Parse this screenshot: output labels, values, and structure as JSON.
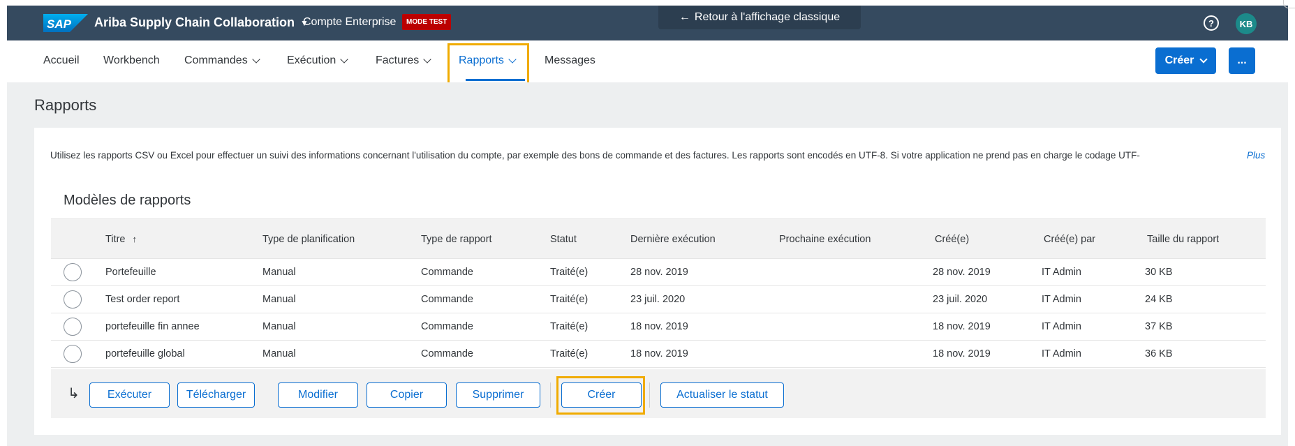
{
  "shell": {
    "logo_text": "SAP",
    "app_title": "Ariba Supply Chain Collaboration",
    "account": "Compte Enterprise",
    "mode_badge": "MODE TEST",
    "classic_view": "Retour à l'affichage classique",
    "help_icon_glyph": "?",
    "avatar_initials": "KB"
  },
  "nav": {
    "items": [
      {
        "label": "Accueil"
      },
      {
        "label": "Workbench"
      },
      {
        "label": "Commandes"
      },
      {
        "label": "Exécution"
      },
      {
        "label": "Factures"
      },
      {
        "label": "Rapports"
      },
      {
        "label": "Messages"
      }
    ],
    "active": "Rapports",
    "create_label": "Créer",
    "more_label": "..."
  },
  "page": {
    "title": "Rapports",
    "intro": "Utilisez les rapports CSV ou Excel pour effectuer un suivi des informations concernant l'utilisation du compte, par exemple des bons de commande et des factures. Les rapports sont encodés en UTF-8. Si votre application ne prend pas en charge le codage UTF-",
    "more_link": "Plus"
  },
  "templates": {
    "title": "Modèles de rapports",
    "columns": [
      "Titre",
      "Type de planification",
      "Type de rapport",
      "Statut",
      "Dernière exécution",
      "Prochaine exécution",
      "Créé(e)",
      "Créé(e) par",
      "Taille du rapport"
    ],
    "sort_glyph": "↑",
    "rows": [
      {
        "title": "Portefeuille",
        "schedule": "Manual",
        "type": "Commande",
        "status": "Traité(e)",
        "last_run": "28 nov. 2019",
        "next_run": "",
        "created": "28 nov. 2019",
        "created_by": "IT Admin",
        "size": "30 KB"
      },
      {
        "title": "Test order report",
        "schedule": "Manual",
        "type": "Commande",
        "status": "Traité(e)",
        "last_run": "23 juil. 2020",
        "next_run": "",
        "created": "23 juil. 2020",
        "created_by": "IT Admin",
        "size": "24 KB"
      },
      {
        "title": "portefeuille fin annee",
        "schedule": "Manual",
        "type": "Commande",
        "status": "Traité(e)",
        "last_run": "18 nov. 2019",
        "next_run": "",
        "created": "18 nov. 2019",
        "created_by": "IT Admin",
        "size": "37 KB"
      },
      {
        "title": "portefeuille global",
        "schedule": "Manual",
        "type": "Commande",
        "status": "Traité(e)",
        "last_run": "18 nov. 2019",
        "next_run": "",
        "created": "18 nov. 2019",
        "created_by": "IT Admin",
        "size": "36 KB"
      }
    ]
  },
  "actions": {
    "return_glyph": "↳",
    "execute": "Exécuter",
    "download": "Télécharger",
    "edit": "Modifier",
    "copy": "Copier",
    "delete": "Supprimer",
    "create": "Créer",
    "refresh_status": "Actualiser le statut"
  },
  "colors": {
    "shell_bg": "#354a5f",
    "accent": "#0a6ed1",
    "highlight": "#f0ab00",
    "badge": "#bb0000",
    "avatar": "#1c8a8a"
  }
}
